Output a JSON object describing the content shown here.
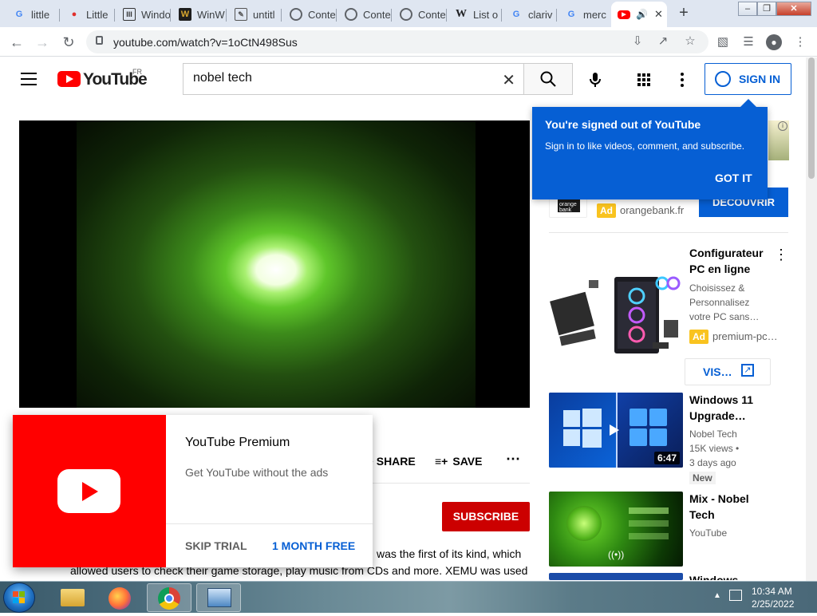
{
  "browser": {
    "tabs": [
      {
        "label": "little",
        "favicon": "google-icon",
        "color": "#4285f4"
      },
      {
        "label": "Little",
        "favicon": "flame-icon",
        "color": "#e0302c"
      },
      {
        "label": "Windo",
        "favicon": "library-icon",
        "color": "#333333"
      },
      {
        "label": "WinW",
        "favicon": "w-logo-icon",
        "color": "#c79a2a"
      },
      {
        "label": "untitl",
        "favicon": "notebook-icon",
        "color": "#555555"
      },
      {
        "label": "Conte",
        "favicon": "globe-icon",
        "color": "#5f6368"
      },
      {
        "label": "Conte",
        "favicon": "globe-icon",
        "color": "#5f6368"
      },
      {
        "label": "Conte",
        "favicon": "globe-icon",
        "color": "#5f6368"
      },
      {
        "label": "List o",
        "favicon": "wikipedia-icon",
        "color": "#202124"
      },
      {
        "label": "clariv",
        "favicon": "google-icon",
        "color": "#4285f4"
      },
      {
        "label": "merc",
        "favicon": "google-icon",
        "color": "#4285f4"
      },
      {
        "label": "",
        "favicon": "youtube-icon",
        "color": "#ff0000"
      }
    ],
    "new_tab": "+",
    "url": "youtube.com/watch?v=1oCtN498Sus"
  },
  "youtube": {
    "logo_text": "YouTube",
    "region": "FR",
    "search_value": "nobel tech",
    "sign_in": "SIGN IN",
    "tooltip": {
      "title": "You're signed out of YouTube",
      "body": "Sign in to like videos, comment, and subscribe.",
      "button": "GOT IT"
    },
    "actions": {
      "share": "SHARE",
      "save": "SAVE"
    },
    "subscribe": "SUBSCRIBE",
    "description": {
      "line1": "was the first of its kind, which",
      "line2": "allowed users to check their game storage, play music from CDs and more. XEMU was used"
    },
    "premium_popup": {
      "title": "YouTube Premium",
      "subtitle": "Get YouTube without the ads",
      "skip": "SKIP TRIAL",
      "offer": "1 MONTH FREE"
    },
    "sidebar": {
      "ad1": {
        "badge": "Ad",
        "domain": "orangebank.fr",
        "cta": "DÉCOUVRIR",
        "brand_small": "orange bank"
      },
      "ad2": {
        "title_line1": "Configurateur",
        "title_line2": "PC en ligne",
        "desc_line1": "Choisissez &",
        "desc_line2": "Personnalisez",
        "desc_line3": "votre PC sans…",
        "badge": "Ad",
        "domain": "premium-pc…",
        "visit": "VIS…"
      },
      "videos": [
        {
          "title_line1": "Windows 11",
          "title_line2": "Upgrade…",
          "channel": "Nobel Tech",
          "views": "15K views •",
          "age": "3 days ago",
          "badge": "New",
          "duration": "6:47"
        },
        {
          "title_line1": "Mix - Nobel",
          "title_line2": "Tech",
          "channel": "YouTube"
        },
        {
          "title_line1": "Windows"
        }
      ]
    }
  },
  "taskbar": {
    "time": "10:34 AM",
    "date": "2/25/2022"
  }
}
